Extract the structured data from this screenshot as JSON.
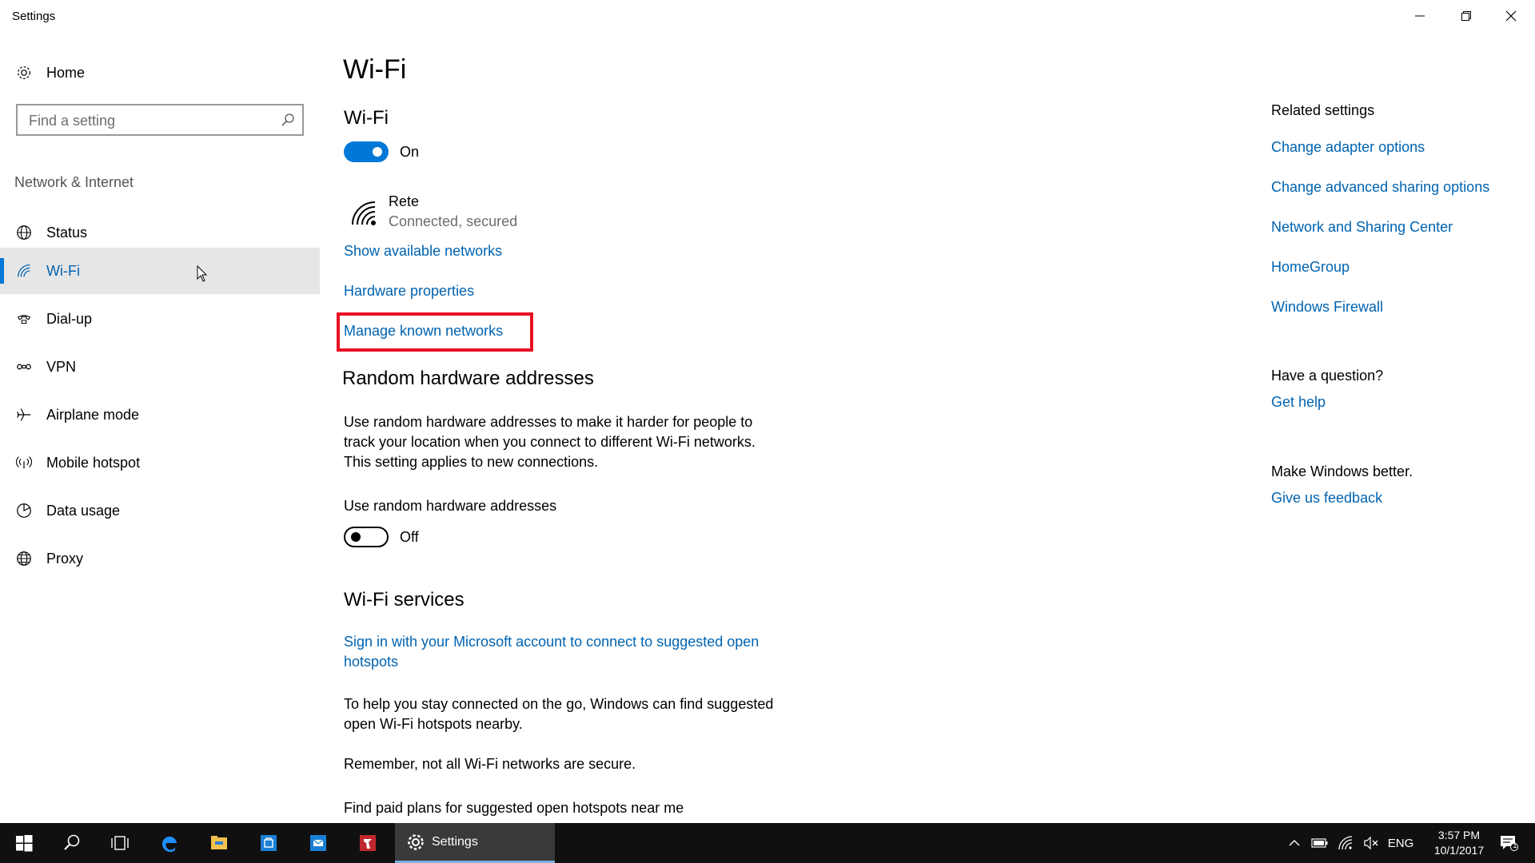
{
  "window": {
    "title": "Settings"
  },
  "sidebar": {
    "home_label": "Home",
    "search_placeholder": "Find a setting",
    "section_label": "Network & Internet",
    "items": [
      {
        "label": "Status",
        "icon": "globe-status-icon"
      },
      {
        "label": "Wi-Fi",
        "icon": "wifi-icon",
        "active": true
      },
      {
        "label": "Dial-up",
        "icon": "dialup-icon"
      },
      {
        "label": "VPN",
        "icon": "vpn-icon"
      },
      {
        "label": "Airplane mode",
        "icon": "airplane-icon"
      },
      {
        "label": "Mobile hotspot",
        "icon": "hotspot-icon"
      },
      {
        "label": "Data usage",
        "icon": "data-usage-icon"
      },
      {
        "label": "Proxy",
        "icon": "globe-icon"
      }
    ]
  },
  "main": {
    "page_title": "Wi-Fi",
    "wifi_heading": "Wi-Fi",
    "wifi_toggle_state": "On",
    "network": {
      "name": "Rete",
      "status": "Connected, secured"
    },
    "links": {
      "show_available": "Show available networks",
      "hardware_properties": "Hardware properties",
      "manage_known": "Manage known networks"
    },
    "random_hw": {
      "heading": "Random hardware addresses",
      "description_1": "Use random hardware addresses to make it harder for people to",
      "description_2": "track your location when you connect to different Wi-Fi networks.",
      "description_3": "This setting applies to new connections.",
      "toggle_label": "Use random hardware addresses",
      "toggle_state": "Off"
    },
    "wifi_services": {
      "heading": "Wi-Fi services",
      "signin_link_1": "Sign in with your Microsoft account to connect to suggested open",
      "signin_link_2": "hotspots",
      "help_1": "To help you stay connected on the go, Windows can find suggested",
      "help_2": "open Wi-Fi hotspots nearby.",
      "remember": "Remember, not all Wi-Fi networks are secure.",
      "paid_plans": "Find paid plans for suggested open hotspots near me"
    }
  },
  "related": {
    "heading": "Related settings",
    "links": [
      "Change adapter options",
      "Change advanced sharing options",
      "Network and Sharing Center",
      "HomeGroup",
      "Windows Firewall"
    ],
    "question_heading": "Have a question?",
    "get_help": "Get help",
    "better_heading": "Make Windows better.",
    "feedback": "Give us feedback"
  },
  "taskbar": {
    "settings_label": "Settings",
    "language": "ENG",
    "time": "3:57 PM",
    "date": "10/1/2017",
    "notification_count": "1"
  },
  "colors": {
    "accent": "#0078d7",
    "link": "#0063b1",
    "highlight": "#e81123"
  }
}
